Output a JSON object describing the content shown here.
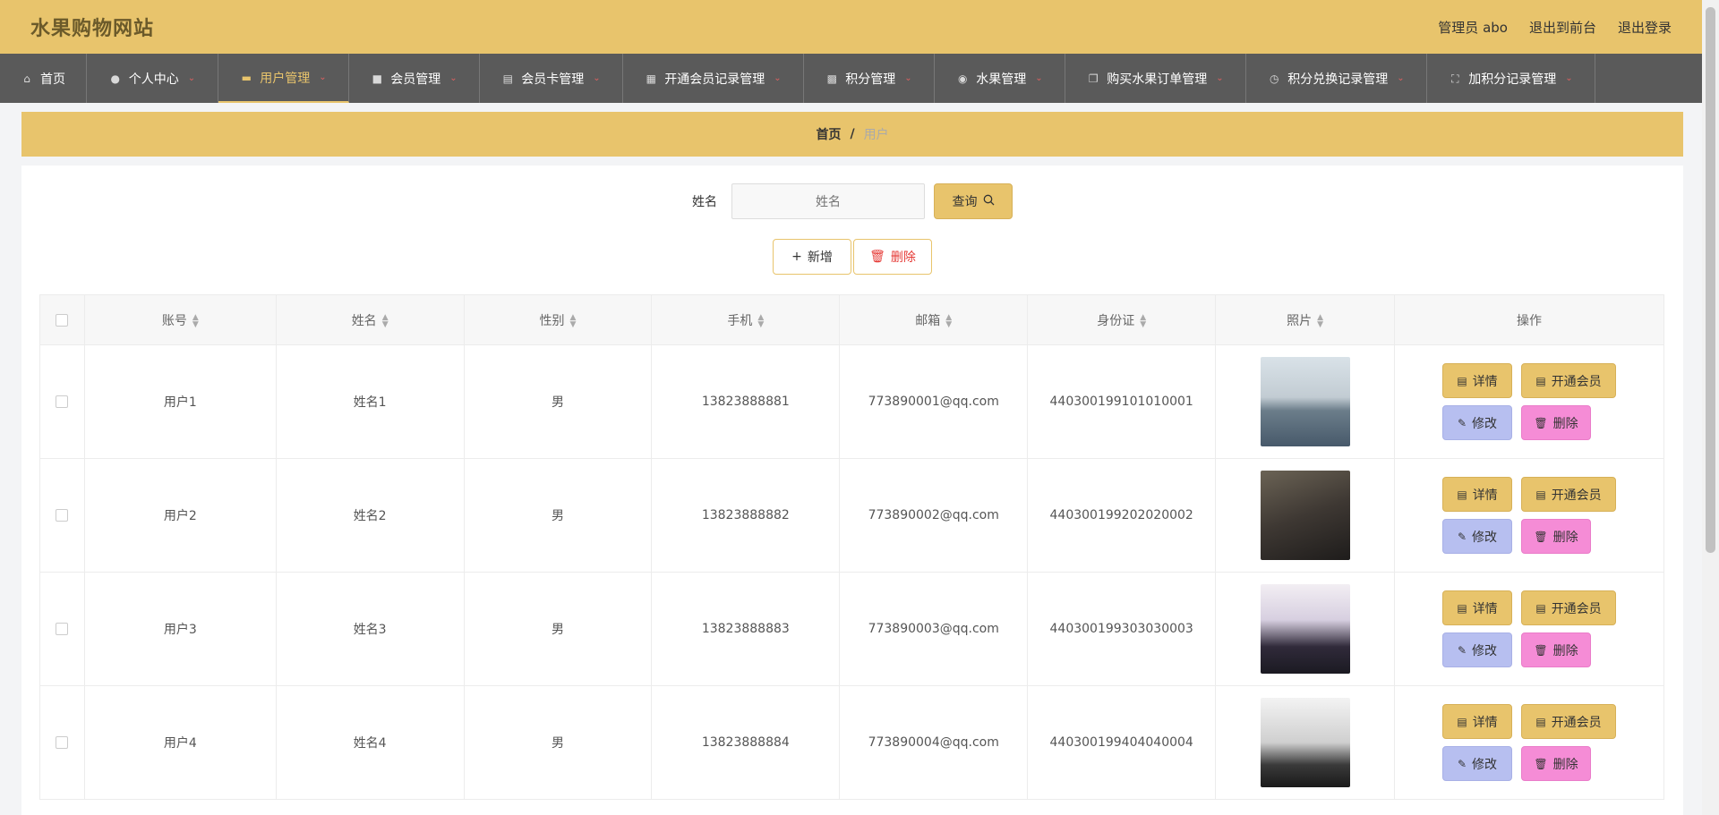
{
  "header": {
    "site_title": "水果购物网站",
    "admin_label": "管理员 abo",
    "back_frontend": "退出到前台",
    "logout": "退出登录"
  },
  "nav": [
    {
      "label": "首页",
      "icon": "home-icon"
    },
    {
      "label": "个人中心",
      "icon": "user-icon"
    },
    {
      "label": "用户管理",
      "icon": "ticket-icon",
      "active": true
    },
    {
      "label": "会员管理",
      "icon": "stack-icon"
    },
    {
      "label": "会员卡管理",
      "icon": "clipboard-icon"
    },
    {
      "label": "开通会员记录管理",
      "icon": "grid-icon"
    },
    {
      "label": "积分管理",
      "icon": "chat-icon"
    },
    {
      "label": "水果管理",
      "icon": "location-icon"
    },
    {
      "label": "购买水果订单管理",
      "icon": "copy-icon"
    },
    {
      "label": "积分兑换记录管理",
      "icon": "clock-icon"
    },
    {
      "label": "加积分记录管理",
      "icon": "fullscreen-icon"
    }
  ],
  "breadcrumb": {
    "home": "首页",
    "separator": "/",
    "current": "用户"
  },
  "search": {
    "label": "姓名",
    "placeholder": "姓名",
    "query_button": "查询"
  },
  "actions": {
    "add": "新增",
    "delete": "删除"
  },
  "table": {
    "columns": [
      "账号",
      "姓名",
      "性别",
      "手机",
      "邮箱",
      "身份证",
      "照片",
      "操作"
    ],
    "rows": [
      {
        "account": "用户1",
        "name": "姓名1",
        "gender": "男",
        "phone": "13823888881",
        "email": "773890001@qq.com",
        "id_card": "440300199101010001"
      },
      {
        "account": "用户2",
        "name": "姓名2",
        "gender": "男",
        "phone": "13823888882",
        "email": "773890002@qq.com",
        "id_card": "440300199202020002"
      },
      {
        "account": "用户3",
        "name": "姓名3",
        "gender": "男",
        "phone": "13823888883",
        "email": "773890003@qq.com",
        "id_card": "440300199303030003"
      },
      {
        "account": "用户4",
        "name": "姓名4",
        "gender": "男",
        "phone": "13823888884",
        "email": "773890004@qq.com",
        "id_card": "440300199404040004"
      }
    ],
    "row_actions": {
      "detail": "详情",
      "open_member": "开通会员",
      "edit": "修改",
      "remove": "删除"
    }
  },
  "colors": {
    "accent": "#e8c46c",
    "nav_bg": "#5a5a5a",
    "edit_btn": "#b7bff0",
    "delete_btn": "#f58cd6"
  }
}
